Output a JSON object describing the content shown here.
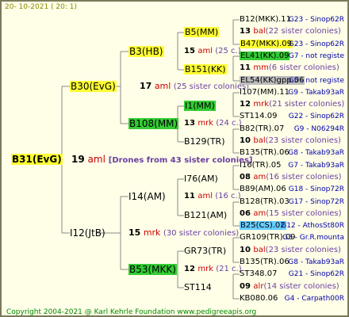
{
  "header": "20-  10-2021  ( 20:   1)",
  "root": {
    "name": "B31(EvG)",
    "gen": "19",
    "race": "aml",
    "note": "[Drones from 43 sister colonies]"
  },
  "p_upper": {
    "name": "B30(EvG)",
    "gen": "17",
    "race": "aml",
    "note": "(25 sister colonies)"
  },
  "p_lower": {
    "name": "I12(JtB)",
    "gen": "15",
    "race": "mrk",
    "note": "(30 sister colonies)"
  },
  "g": [
    {
      "name": "B3(HB)",
      "gen": "15",
      "race": "aml",
      "note": "(25 c.)"
    },
    {
      "name": "B108(MM)",
      "gen": "13",
      "race": "mrk",
      "note": "(24 c.)"
    },
    {
      "name": "I14(AM)",
      "gen": "11",
      "race": "aml",
      "note": "(16 c.)"
    },
    {
      "name": "B53(MKK)",
      "gen": "12",
      "race": "mrk",
      "note": "(21 c.)"
    }
  ],
  "gg": [
    "B5(MM)",
    "B151(KK)",
    "I1(MM)",
    "B129(TR)",
    "I76(AM)",
    "B121(AM)",
    "GR73(TR)",
    "ST114"
  ],
  "rows": [
    {
      "type": "n",
      "name": "B12(MKK).11",
      "ref": "G23 - Sinop62R"
    },
    {
      "type": "d",
      "gen": "13",
      "race": "bal",
      "note": "(22 sister colonies)"
    },
    {
      "type": "n",
      "name": "B47(MKK).09",
      "ref": "G23 - Sinop62R"
    },
    {
      "type": "n",
      "name": "EL41(KK).09",
      "ref": "G7 - not registe"
    },
    {
      "type": "d",
      "gen": "11",
      "race": "mm",
      "note": "(6 sister colonies)"
    },
    {
      "type": "n",
      "name": "EL54(KK)gpp.06",
      "ref": "G5 - not registe"
    },
    {
      "type": "n",
      "name": "I107(MM).11",
      "ref": "G9 - Takab93aR"
    },
    {
      "type": "d",
      "gen": "12",
      "race": "mrk",
      "note": "(21 sister colonies)"
    },
    {
      "type": "n",
      "name": "ST114.09",
      "ref": "G22 - Sinop62R"
    },
    {
      "type": "n",
      "name": "B82(TR).07",
      "ref": "G9 - N06294R"
    },
    {
      "type": "d",
      "gen": "10",
      "race": "bal",
      "note": "(23 sister colonies)"
    },
    {
      "type": "n",
      "name": "B135(TR).06",
      "ref": "G8 - Takab93aR"
    },
    {
      "type": "n",
      "name": "I16(TR).05",
      "ref": "G7 - Takab93aR"
    },
    {
      "type": "d",
      "gen": "08",
      "race": "am",
      "note": "(16 sister colonies)"
    },
    {
      "type": "n",
      "name": "B89(AM).06",
      "ref": "G18 - Sinop72R"
    },
    {
      "type": "n",
      "name": "B128(TR).03",
      "ref": "G17 - Sinop72R"
    },
    {
      "type": "d",
      "gen": "06",
      "race": "am",
      "note": "(15 sister colonies)"
    },
    {
      "type": "n",
      "name": "B25(CS).02",
      "ref": "G12 - AthosSt80R"
    },
    {
      "type": "n",
      "name": "GR109(TR).09",
      "ref": "G3 - Gr.R.mounta"
    },
    {
      "type": "d",
      "gen": "10",
      "race": "bal",
      "note": "(23 sister colonies)"
    },
    {
      "type": "n",
      "name": "B135(TR).06",
      "ref": "G8 - Takab93aR"
    },
    {
      "type": "n",
      "name": "ST348.07",
      "ref": "G21 - Sinop62R"
    },
    {
      "type": "d",
      "gen": "09",
      "race": "alr",
      "note": "(14 sister colonies)"
    },
    {
      "type": "n",
      "name": "KB080.06",
      "ref": "G4 - Carpath00R"
    }
  ],
  "footer": "Copyright 2004-2021 @ Karl Kehrle Foundation   www.pedigreeapis.org",
  "colors": {
    "background": "#ffffe8",
    "yellow": "#ffff33",
    "green": "#33cc33",
    "gray": "#bbbbbb",
    "blue": "#66ccff",
    "race": "#cc0000",
    "ref": "#0000aa",
    "note": "#6a3fa0"
  },
  "highlights": {
    "root": "yellow",
    "p_upper": "yellow",
    "g": [
      "yellow",
      "green",
      "",
      "green"
    ],
    "gg": [
      "yellow",
      "yellow",
      "green",
      "",
      "",
      "",
      "",
      ""
    ],
    "rows": {
      "2": "yellow",
      "3": "green",
      "5": "gray",
      "17": "blue"
    }
  }
}
